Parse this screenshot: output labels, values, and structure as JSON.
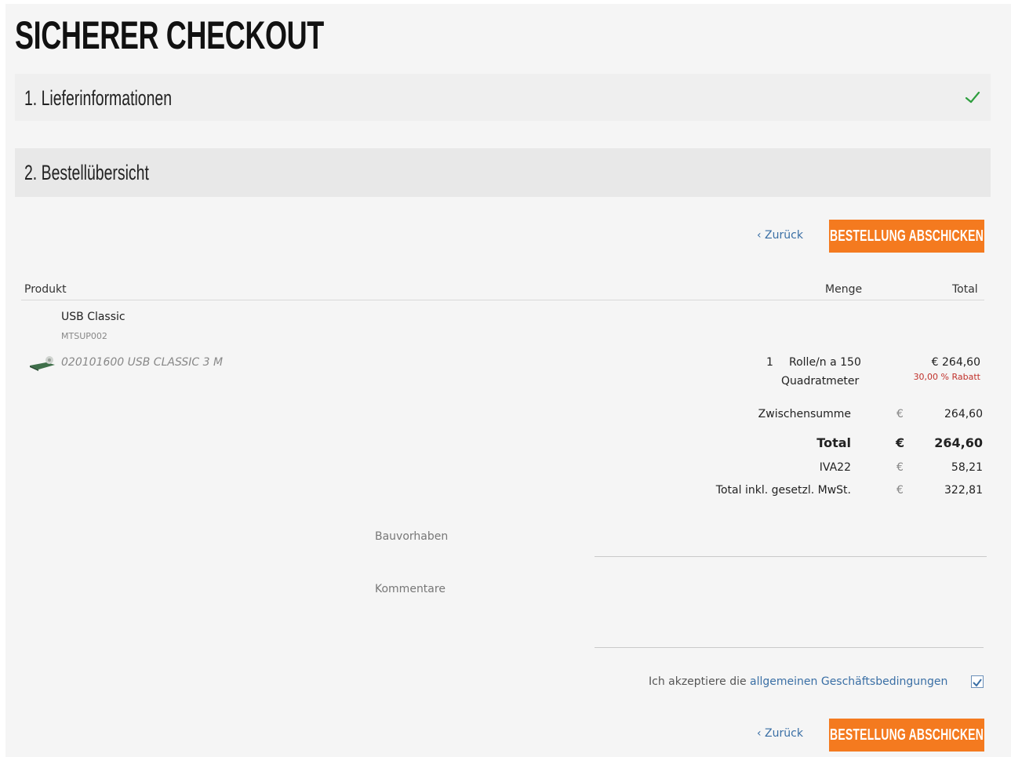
{
  "page": {
    "title": "SICHERER CHECKOUT"
  },
  "steps": [
    {
      "label": "1.  Lieferinformationen",
      "completed": true,
      "check_icon": "checkmark-icon",
      "check_color": "#2e9e3e"
    },
    {
      "label": "2.  Bestellübersicht",
      "completed": false
    }
  ],
  "actions": {
    "back_label": "‹ Zurück",
    "submit_label": "BESTELLUNG ABSCHICKEN",
    "submit_color": "#f47a1f",
    "link_color": "#3a6fa5"
  },
  "table": {
    "columns": {
      "product": "Produkt",
      "quantity": "Menge",
      "total": "Total"
    },
    "item": {
      "name": "USB Classic",
      "sku": "MTSUP002",
      "variant": "020101600 USB CLASSIC 3 M",
      "thumbnail_icon": "product-roll-icon",
      "qty": "1",
      "unit_line1": "Rolle/n a 150",
      "unit_line2": "Quadratmeter",
      "price": "€ 264,60",
      "discount": "30,00 % Rabatt",
      "discount_color": "#c0312b"
    }
  },
  "summary": [
    {
      "label": "Zwischensumme",
      "currency": "€",
      "amount": "264,60"
    },
    {
      "label": "Total",
      "currency": "€",
      "amount": "264,60",
      "bold": true
    },
    {
      "label": "IVA22",
      "currency": "€",
      "amount": "58,21"
    },
    {
      "label": "Total inkl. gesetzl. MwSt.",
      "currency": "€",
      "amount": "322,81"
    }
  ],
  "form": {
    "project_label": "Bauvorhaben",
    "project_value": "",
    "comment_label": "Kommentare",
    "comment_value": ""
  },
  "terms": {
    "prefix": "Ich akzeptiere die",
    "link": "allgemeinen Geschäftsbedingungen",
    "checked": true
  }
}
